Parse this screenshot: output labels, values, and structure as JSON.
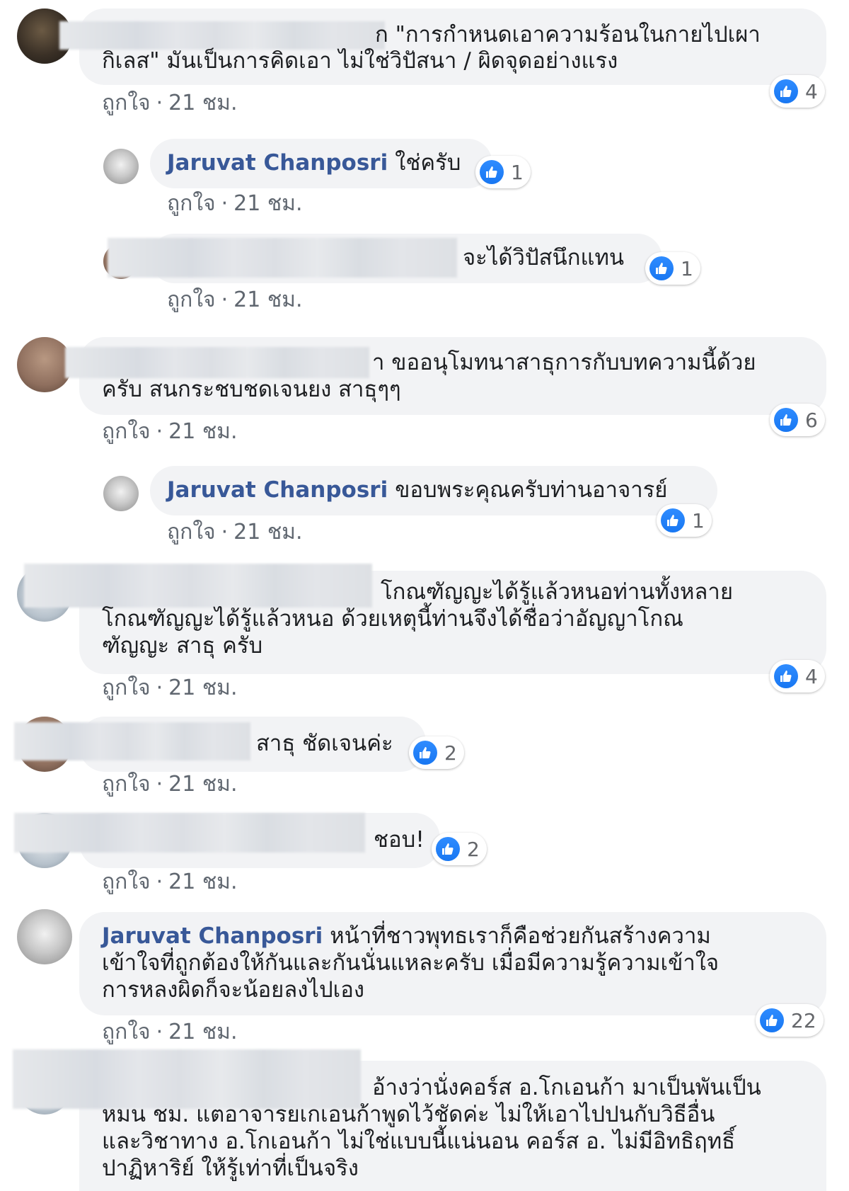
{
  "meta": {
    "like_label": "ถูกใจ",
    "separator": "·",
    "time": "21 ชม."
  },
  "colors": {
    "author": "#385898",
    "bubble": "#f2f3f5",
    "meta": "#606770",
    "like_blue": "#1877f2"
  },
  "comments": [
    {
      "id": "c1",
      "author": "",
      "lines": [
        "ก \"การกำหนดเอาความร้อนในกายไปเผา",
        "กิเลส\" มันเป็นการคิดเอา ไม่ใช่วิปัสนา / ผิดจุดอย่างแรง"
      ],
      "likes": "4"
    },
    {
      "id": "c2",
      "author": "Jaruvat Chanposri",
      "lines": [
        "ใช่ครับ"
      ],
      "likes": "1"
    },
    {
      "id": "c3",
      "author": "",
      "lines": [
        "จะได้วิปัสนึกแทน"
      ],
      "likes": "1"
    },
    {
      "id": "c4",
      "author": "",
      "lines": [
        "า ขออนุโมทนาสาธุการกับบทความนี้ด้วย",
        "ครับ สนกระชบชดเจนยง สาธุๆๆ"
      ],
      "likes": "6"
    },
    {
      "id": "c5",
      "author": "Jaruvat Chanposri",
      "lines": [
        "ขอบพระคุณครับท่านอาจารย์"
      ],
      "likes": "1"
    },
    {
      "id": "c6",
      "author": "",
      "lines": [
        "โกณฑัญญะได้รู้แล้วหนอท่านทั้งหลาย",
        "โกณฑัญญะได้รู้แล้วหนอ ด้วยเหตุนี้ท่านจึงได้ชื่อว่าอัญญาโกณ",
        "ฑัญญะ สาธุ ครับ"
      ],
      "likes": "4"
    },
    {
      "id": "c7",
      "author": "",
      "lines": [
        "สาธุ ชัดเจนค่ะ"
      ],
      "likes": "2"
    },
    {
      "id": "c8",
      "author": "",
      "lines": [
        "ชอบ!"
      ],
      "likes": "2"
    },
    {
      "id": "c9",
      "author": "Jaruvat Chanposri",
      "lines": [
        "หน้าที่ชาวพุทธเราก็คือช่วยกันสร้างความ",
        "เข้าใจที่ถูกต้องให้กันและกันนั่นแหละครับ เมื่อมีความรู้ความเข้าใจ",
        "การหลงผิดก็จะน้อยลงไปเอง"
      ],
      "likes": "22"
    },
    {
      "id": "c10",
      "author": "",
      "lines": [
        "อ้างว่านั่งคอร์ส อ.โกเอนก้า มาเป็นพันเป็น",
        "หมน ชม. แตอาจารยเกเอนก้าพูดไว้ชัดค่ะ ไม่ให้เอาไปปนกับวิธีอื่น",
        "และวิชาทาง อ.โกเอนก้า ไม่ใช่แบบนี้แน่นอน คอร์ส อ. ไม่มีอิทธิฤทธิ์",
        "ปาฏิหาริย์ ให้รู้เท่าที่เป็นจริง"
      ],
      "likes": ""
    }
  ]
}
